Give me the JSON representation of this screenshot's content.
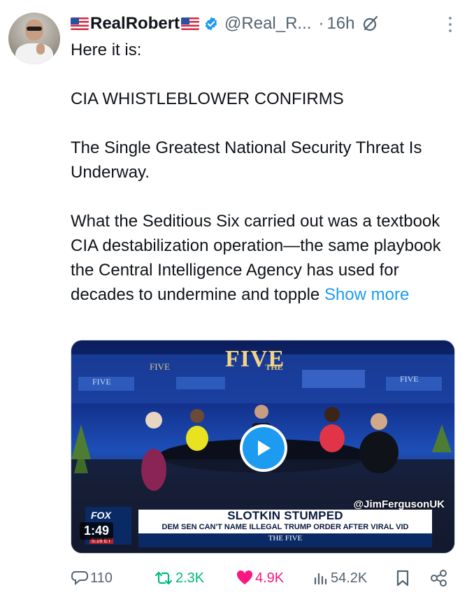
{
  "author": {
    "display_name": "RealRobert",
    "handle": "@Real_R...",
    "separator": "·",
    "time": "16h",
    "verified_color": "#1d9bf0"
  },
  "tweet": {
    "paragraphs": [
      "Here it is:",
      "CIA WHISTLEBLOWER CONFIRMS",
      "The Single Greatest National Security Threat Is Underway.",
      "What the Seditious Six carried out was a textbook CIA destabilization operation—the same playbook the Central Intelligence Agency has used for decades to undermine and topple"
    ],
    "show_more": "Show more"
  },
  "media": {
    "show_title": "THE FIVE",
    "show_title_small": "THE",
    "show_logo": "FIVE",
    "duration": "1:49",
    "watermark": "@JimFergusonUK",
    "headline": "SLOTKIN STUMPED",
    "subheadline": "DEM SEN CAN'T NAME ILLEGAL TRUMP ORDER AFTER VIRAL VID",
    "bottom_bar": "THE FIVE",
    "network": "FOX",
    "clock": "5:16 ET"
  },
  "actions": {
    "replies": "110",
    "retweets": "2.3K",
    "likes": "4.9K",
    "views": "54.2K",
    "reply_color": "#536471",
    "retweet_color": "#00ba7c",
    "like_color": "#f91880"
  }
}
